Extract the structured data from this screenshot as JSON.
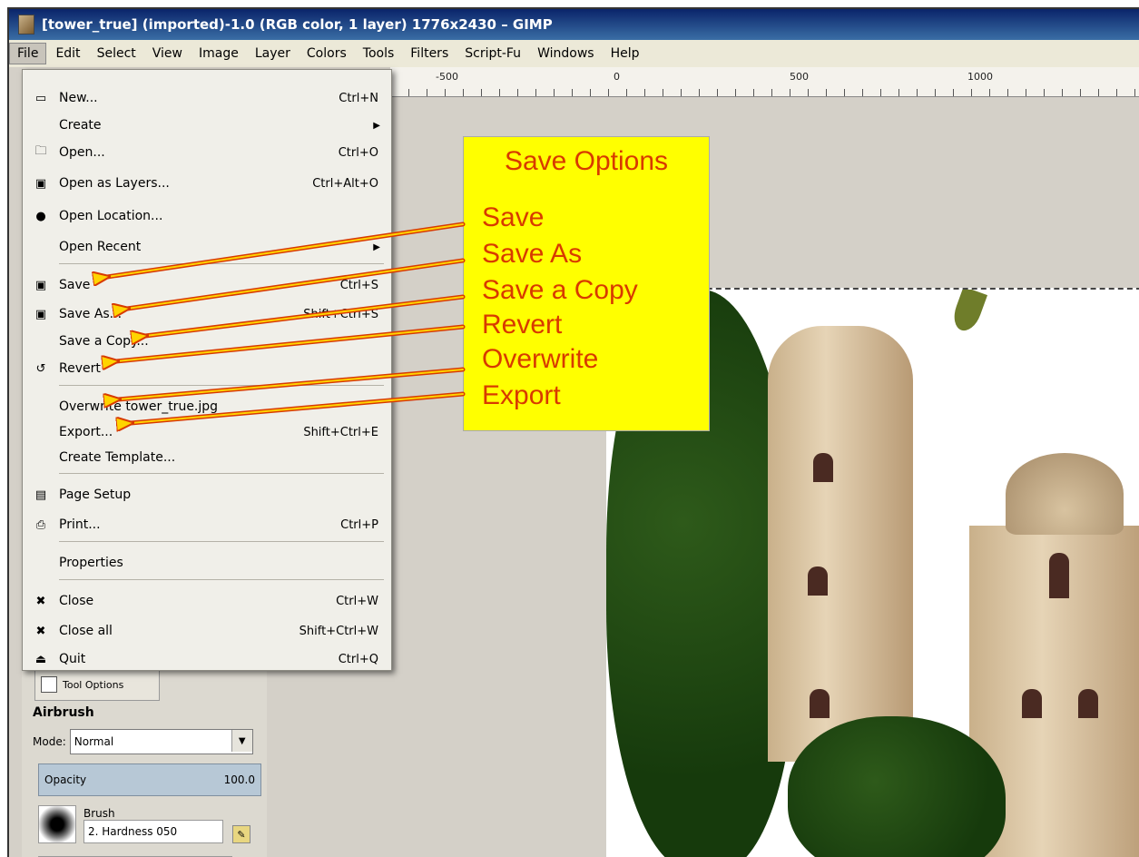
{
  "window": {
    "title": "[tower_true] (imported)-1.0 (RGB color, 1 layer) 1776x2430 – GIMP"
  },
  "menubar": [
    "File",
    "Edit",
    "Select",
    "View",
    "Image",
    "Layer",
    "Colors",
    "Tools",
    "Filters",
    "Script-Fu",
    "Windows",
    "Help"
  ],
  "ruler": {
    "labels": [
      "-500",
      "0",
      "500",
      "1000"
    ]
  },
  "file_menu": {
    "items": [
      {
        "label": "New...",
        "shortcut": "Ctrl+N",
        "icon": "new-file-icon"
      },
      {
        "label": "Create",
        "shortcut": "",
        "icon": "",
        "submenu": true
      },
      {
        "label": "Open...",
        "shortcut": "Ctrl+O",
        "icon": "open-folder-icon"
      },
      {
        "label": "Open as Layers...",
        "shortcut": "Ctrl+Alt+O",
        "icon": "open-layers-icon"
      },
      {
        "label": "Open Location...",
        "shortcut": "",
        "icon": "globe-icon"
      },
      {
        "label": "Open Recent",
        "shortcut": "",
        "icon": "",
        "submenu": true
      },
      {
        "label": "Save",
        "shortcut": "Ctrl+S",
        "icon": "save-icon"
      },
      {
        "label": "Save As...",
        "shortcut": "Shift+Ctrl+S",
        "icon": "save-as-icon"
      },
      {
        "label": "Save a Copy...",
        "shortcut": "",
        "icon": ""
      },
      {
        "label": "Revert",
        "shortcut": "",
        "icon": "revert-icon"
      },
      {
        "label": "Overwrite tower_true.jpg",
        "shortcut": "",
        "icon": ""
      },
      {
        "label": "Export...",
        "shortcut": "Shift+Ctrl+E",
        "icon": ""
      },
      {
        "label": "Create Template...",
        "shortcut": "",
        "icon": ""
      },
      {
        "label": "Page Setup",
        "shortcut": "",
        "icon": "page-setup-icon"
      },
      {
        "label": "Print...",
        "shortcut": "Ctrl+P",
        "icon": "print-icon"
      },
      {
        "label": "Properties",
        "shortcut": "",
        "icon": ""
      },
      {
        "label": "Close",
        "shortcut": "Ctrl+W",
        "icon": "close-icon"
      },
      {
        "label": "Close all",
        "shortcut": "Shift+Ctrl+W",
        "icon": "close-all-icon"
      },
      {
        "label": "Quit",
        "shortcut": "Ctrl+Q",
        "icon": "quit-icon"
      }
    ]
  },
  "toolbox": {
    "tab_label": "Tool Options",
    "tool_name": "Airbrush",
    "mode_label": "Mode:",
    "mode_value": "Normal",
    "opacity_label": "Opacity",
    "opacity_value": "100.0",
    "brush_label": "Brush",
    "brush_value": "2. Hardness 050"
  },
  "callout": {
    "title": "Save Options",
    "items": [
      "Save",
      "Save As",
      "Save a Copy",
      "Revert",
      "Overwrite",
      "Export"
    ],
    "bg_color": "#ffff00",
    "text_color": "#d83a00"
  }
}
